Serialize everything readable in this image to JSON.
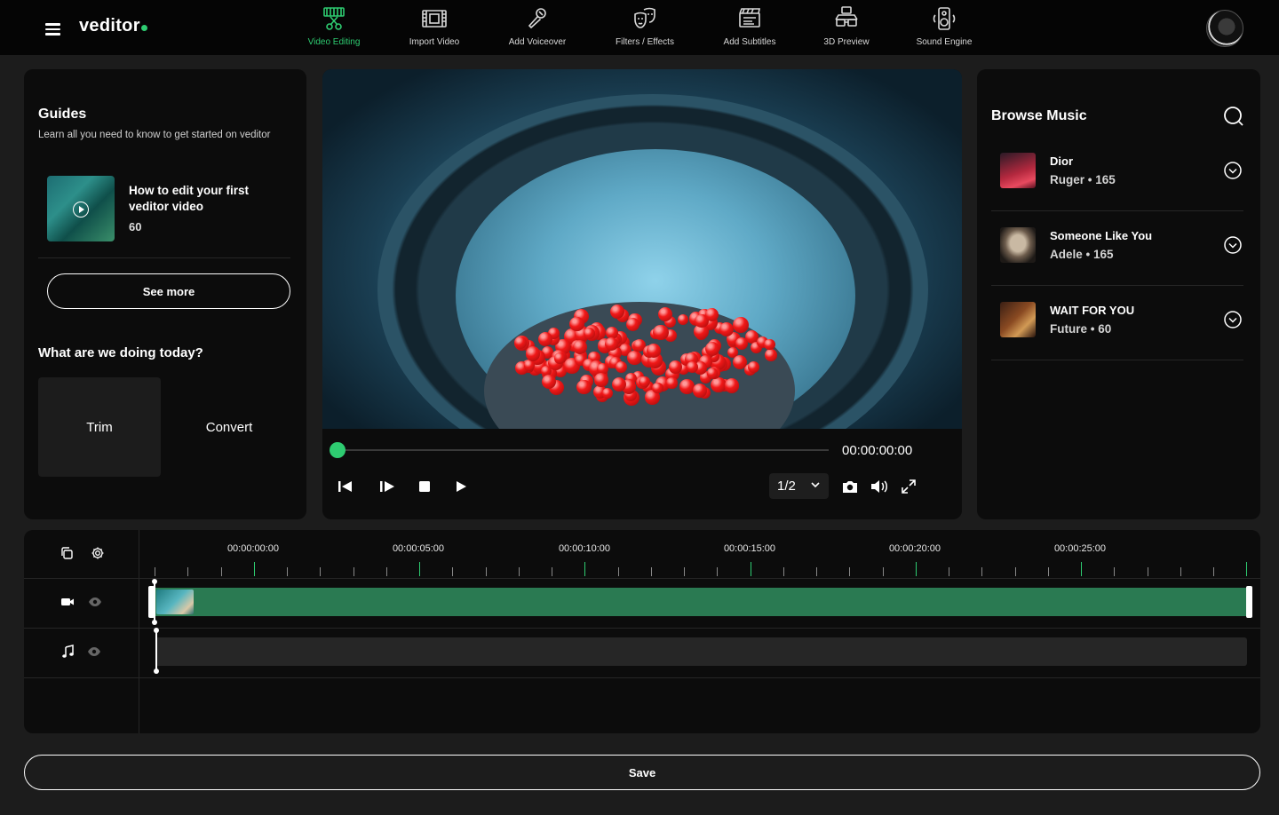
{
  "app": {
    "logo_text": "veditor",
    "accent_color": "#2ecc71"
  },
  "nav": {
    "items": [
      {
        "label": "Video Editing",
        "icon": "film-scissors-icon",
        "active": true
      },
      {
        "label": "Import Video",
        "icon": "film-strip-icon",
        "active": false
      },
      {
        "label": "Add Voiceover",
        "icon": "microphone-icon",
        "active": false
      },
      {
        "label": "Filters / Effects",
        "icon": "theater-masks-icon",
        "active": false
      },
      {
        "label": "Add Subtitles",
        "icon": "subtitles-clapper-icon",
        "active": false
      },
      {
        "label": "3D Preview",
        "icon": "3d-glasses-icon",
        "active": false
      },
      {
        "label": "Sound Engine",
        "icon": "speaker-icon",
        "active": false
      }
    ]
  },
  "guides": {
    "title": "Guides",
    "subtitle": "Learn all you need to know to get started on veditor",
    "card": {
      "title": "How to edit your first veditor video",
      "count": "60"
    },
    "see_more_label": "See more",
    "question": "What are we doing today?",
    "actions": [
      {
        "label": "Trim"
      },
      {
        "label": "Convert"
      }
    ]
  },
  "player": {
    "time": "00:00:00:00",
    "speed": "1/2",
    "progress": 0
  },
  "music": {
    "title": "Browse Music",
    "tracks": [
      {
        "title": "Dior",
        "meta": "Ruger • 165"
      },
      {
        "title": "Someone Like You",
        "meta": "Adele • 165"
      },
      {
        "title": "WAIT FOR YOU",
        "meta": "Future • 60"
      }
    ]
  },
  "timeline": {
    "labels": [
      "00:00:00:00",
      "00:00:05:00",
      "00:00:10:00",
      "00:00:15:00",
      "00:00:20:00",
      "00:00:25:00"
    ]
  },
  "save_label": "Save"
}
